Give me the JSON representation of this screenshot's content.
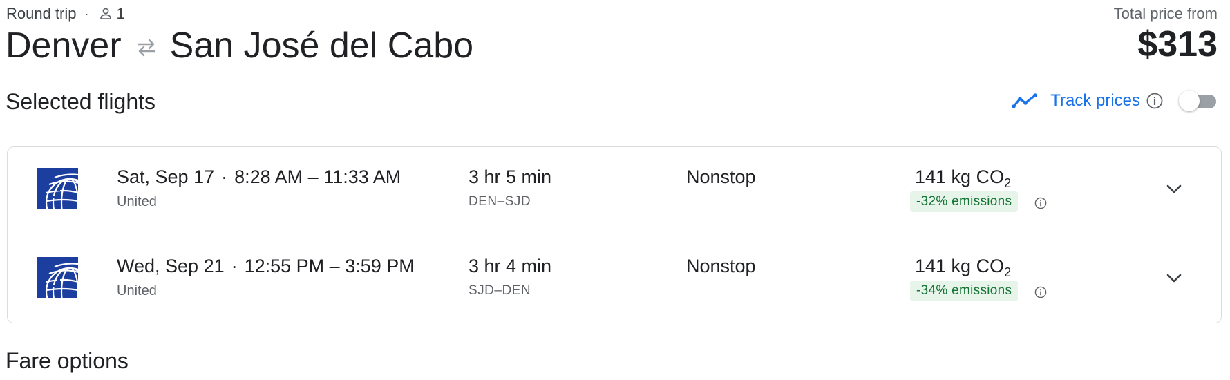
{
  "header": {
    "trip_type": "Round trip",
    "separator": "·",
    "passengers_icon": "person-outline-icon",
    "passengers": "1",
    "origin": "Denver",
    "swap_icon": "round-trip-arrows-icon",
    "destination": "San José del Cabo",
    "total_label": "Total price from",
    "total_price": "$313"
  },
  "selected": {
    "title": "Selected flights",
    "track_icon": "trending-line-icon",
    "track_label": "Track prices",
    "info_icon": "info-icon",
    "toggle_on": false
  },
  "flights": [
    {
      "airline_logo": "united-airlines-logo",
      "date": "Sat, Sep 17",
      "sep": "·",
      "times": "8:28 AM – 11:33 AM",
      "airline": "United",
      "duration": "3 hr 5 min",
      "airports": "DEN–SJD",
      "stops": "Nonstop",
      "emissions_value": "141 kg CO",
      "emissions_sub": "2",
      "emissions_badge": "-32% emissions"
    },
    {
      "airline_logo": "united-airlines-logo",
      "date": "Wed, Sep 21",
      "sep": "·",
      "times": "12:55 PM – 3:59 PM",
      "airline": "United",
      "duration": "3 hr 4 min",
      "airports": "SJD–DEN",
      "stops": "Nonstop",
      "emissions_value": "141 kg CO",
      "emissions_sub": "2",
      "emissions_badge": "-34% emissions"
    }
  ],
  "fare": {
    "title": "Fare options"
  },
  "colors": {
    "accent": "#1a73e8",
    "text_primary": "#202124",
    "text_secondary": "#5f6368",
    "emissions_bg": "#e6f4ea",
    "emissions_text": "#137333",
    "united_blue": "#1c3e9f",
    "border": "#dadce0"
  }
}
